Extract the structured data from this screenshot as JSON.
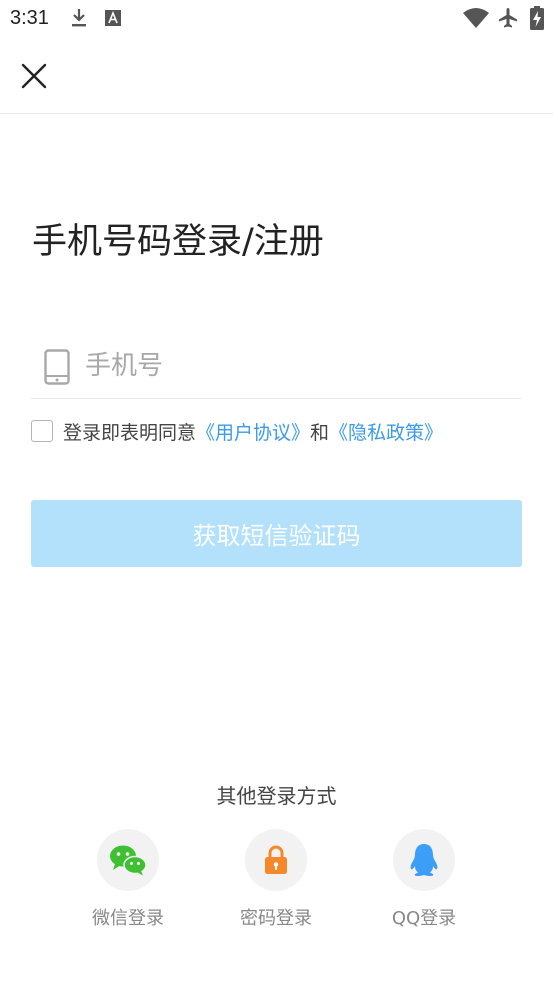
{
  "status_bar": {
    "time": "3:31",
    "icons": [
      "download-icon",
      "font-icon",
      "wifi-icon",
      "airplane-icon",
      "battery-charging-icon"
    ]
  },
  "header": {
    "close_icon": "close-icon"
  },
  "page": {
    "title": "手机号码登录/注册",
    "phone_placeholder": "手机号",
    "phone_value": "",
    "agreement": {
      "prefix": "登录即表明同意",
      "user_agreement": "《用户协议》",
      "and": "和",
      "privacy_policy": "《隐私政策》"
    },
    "sms_button": "获取短信验证码"
  },
  "other_login": {
    "title": "其他登录方式",
    "options": [
      {
        "label": "微信登录",
        "icon": "wechat-icon"
      },
      {
        "label": "密码登录",
        "icon": "lock-icon"
      },
      {
        "label": "QQ登录",
        "icon": "qq-icon"
      }
    ]
  },
  "colors": {
    "accent_link": "#3c9ae8",
    "button_disabled_bg": "#b3e0fb",
    "wechat": "#3fbf32",
    "lock": "#f5892a",
    "qq": "#3d9ef7"
  }
}
